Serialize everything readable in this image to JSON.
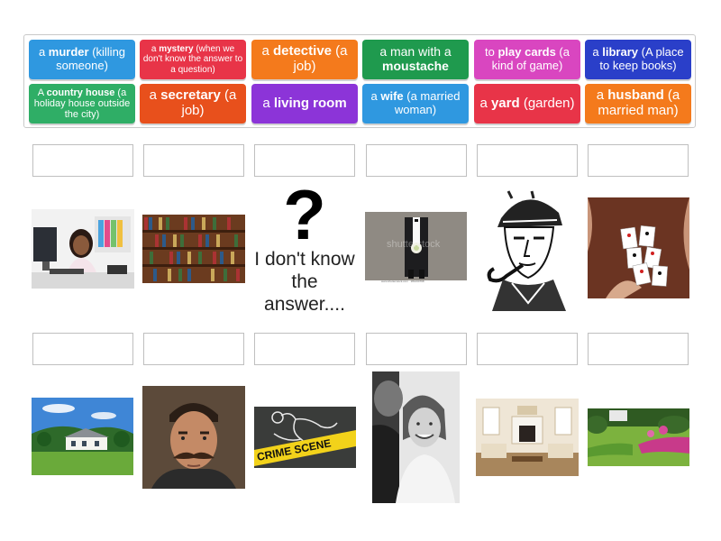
{
  "tiles": [
    {
      "pre": "a ",
      "bold": "murder",
      "post": " (killing someone)",
      "color": "#2f98e0",
      "size": 13
    },
    {
      "pre": "a ",
      "bold": "mystery",
      "post": " (when we don't know the answer to a question)",
      "color": "#e83448",
      "size": 10
    },
    {
      "pre": "a ",
      "bold": "detective",
      "post": " (a job)",
      "color": "#f47a1c",
      "size": 15
    },
    {
      "pre": "a man with a ",
      "bold": "moustache",
      "post": "",
      "color": "#1f9a4e",
      "size": 14
    },
    {
      "pre": "to ",
      "bold": "play cards",
      "post": " (a kind of game)",
      "color": "#d946c0",
      "size": 13
    },
    {
      "pre": "a ",
      "bold": "library",
      "post": " (A place to keep books)",
      "color": "#2a3fc9",
      "size": 13
    },
    {
      "pre": "A ",
      "bold": "country house",
      "post": " (a holiday house outside the city)",
      "color": "#2fae66",
      "size": 11
    },
    {
      "pre": "a ",
      "bold": "secretary",
      "post": " (a job)",
      "color": "#e8501c",
      "size": 15
    },
    {
      "pre": "a ",
      "bold": "living room",
      "post": "",
      "color": "#8c34d8",
      "size": 15
    },
    {
      "pre": "a ",
      "bold": "wife",
      "post": " (a married woman)",
      "color": "#2f98e0",
      "size": 13
    },
    {
      "pre": "a ",
      "bold": "yard",
      "post": " (garden)",
      "color": "#e83448",
      "size": 15
    },
    {
      "pre": "a ",
      "bold": "husband",
      "post": " (a married man)",
      "color": "#f47a1c",
      "size": 15
    }
  ],
  "mystery_card": {
    "mark": "?",
    "text": "I don't know the answer...."
  },
  "images": {
    "row1": [
      "secretary-photo",
      "library-photo",
      "question-card",
      "groom-photo",
      "detective-drawing",
      "cards-photo"
    ],
    "row2": [
      "country-house-photo",
      "moustache-man-photo",
      "crime-scene-photo",
      "wedding-couple-photo",
      "living-room-photo",
      "yard-photo"
    ]
  },
  "watermarks": {
    "groom": "shutterstock",
    "groom_caption": "www.shutterstock.com · 181234798"
  }
}
